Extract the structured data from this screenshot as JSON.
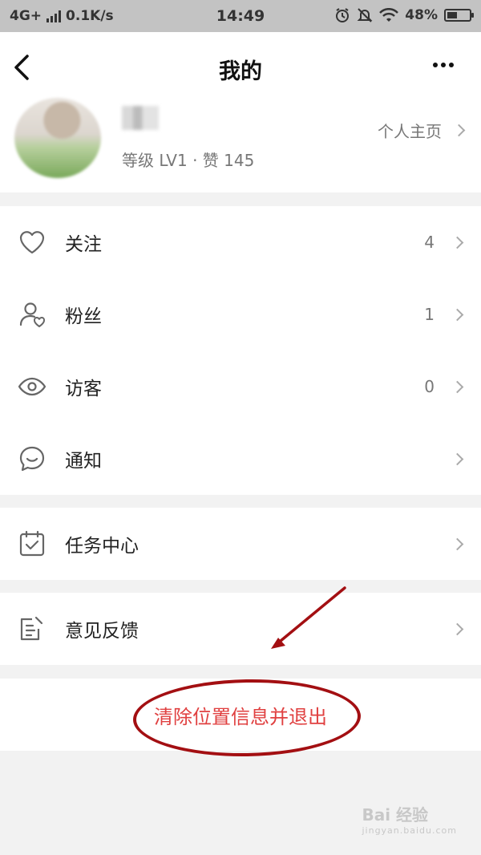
{
  "status_bar": {
    "network": "4G+",
    "speed": "0.1K/s",
    "time": "14:49",
    "battery_percent": "48%",
    "battery_level": 0.48,
    "icons": [
      "alarm-icon",
      "mute-icon",
      "wifi-icon"
    ]
  },
  "header": {
    "title": "我的",
    "back_icon": "chevron-left-icon",
    "more_icon": "more-dots-icon"
  },
  "profile": {
    "level_text": "等级 LV1 · 赞 145",
    "homepage_label": "个人主页"
  },
  "menu": {
    "social": [
      {
        "label": "关注",
        "count": "4",
        "icon": "heart-icon"
      },
      {
        "label": "粉丝",
        "count": "1",
        "icon": "user-heart-icon"
      },
      {
        "label": "访客",
        "count": "0",
        "icon": "eye-icon"
      },
      {
        "label": "通知",
        "count": "",
        "icon": "chat-bubble-icon"
      }
    ],
    "tasks": {
      "label": "任务中心",
      "icon": "clipboard-check-icon"
    },
    "feedback": {
      "label": "意见反馈",
      "icon": "edit-note-icon"
    }
  },
  "logout_label": "清除位置信息并退出",
  "annotation_color": "#a30f12",
  "accent_red": "#e04040",
  "watermark": {
    "text": "Bai 经验",
    "sub": "jingyan.baidu.com"
  }
}
